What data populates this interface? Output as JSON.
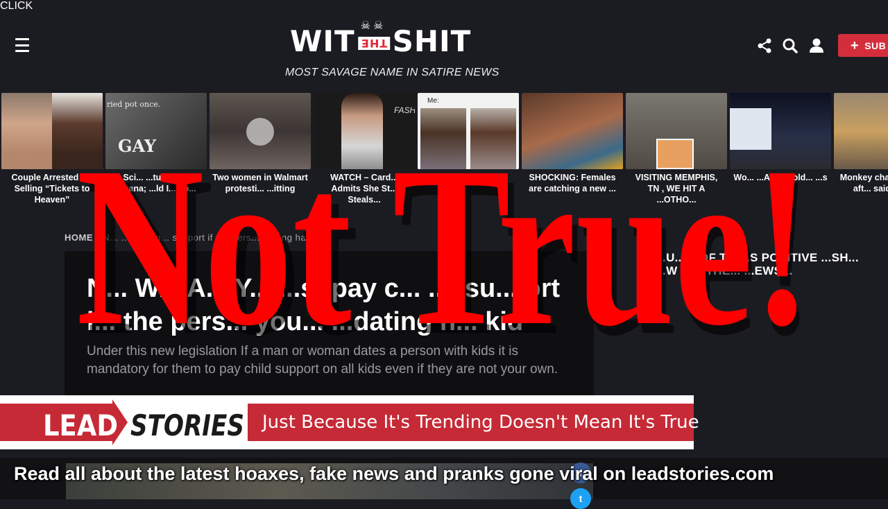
{
  "header": {
    "logo_left": "WIT",
    "logo_mid": "THE",
    "logo_right": "SHIT",
    "logo_small": "CLICK",
    "tagline": "MOST SAVAGE NAME IN SATIRE NEWS",
    "subscribe_label": "SUB"
  },
  "cards": [
    {
      "title": "Couple Arrested for Selling “Tickets to Heaven”"
    },
    {
      "title": "... Sci... ...tudy ...gest ...uana; ...ld I... Fo..."
    },
    {
      "title": "Two women in Walmart protesti... ...itting"
    },
    {
      "title": "WATCH – Card... Admits She St... Steals..."
    },
    {
      "title": "...ing to ...n to ...o"
    },
    {
      "title": "SHOCKING: Females are catching a new ..."
    },
    {
      "title": "VISITING MEMPHIS, TN , WE HIT A ...OTHO..."
    },
    {
      "title": "Wo... ...After Hold... ...s at"
    },
    {
      "title": "Monkey cha... assault aft... said “Da..."
    }
  ],
  "thumb_labels": {
    "card2_top": "ried pot once.",
    "card2_gay": "GAY",
    "card5_me": "Me:",
    "card3_brand": "FASHI"
  },
  "breadcrumb": {
    "home": "HOME",
    "rest": "N... ...V: ...t p... support if the pers... ...ating ha..."
  },
  "article": {
    "headline": "N... W... A... Y... ...st pay c... ...l su... ort i... the pers... you... ...dating h... kid",
    "summary": "Under this new legislation If a man or woman dates a person with kids it is mandatory for them to pay child support on all kids even if they are not your own."
  },
  "sidebar": {
    "text": "...U... ...OF T... ...S POSITIVE ...SH... ...W IN OTHE... ...EWS..."
  },
  "overlay": {
    "stamp": "Not True!",
    "brand_lead": "LEAD",
    "brand_stories": "STORIES",
    "banner_tagline": "Just Because It's Trending Doesn't Mean It's True",
    "bottom_text": "Read all about the latest hoaxes, fake news and pranks gone viral on leadstories.com"
  },
  "colors": {
    "accent": "#d42e3c",
    "stamp_red": "#ff0000",
    "lead_red": "#c62a36",
    "background": "#1b1c22"
  },
  "icons": [
    "menu-icon",
    "share-icon",
    "search-icon",
    "user-icon",
    "plus-icon",
    "play-icon",
    "facebook-icon",
    "twitter-icon"
  ]
}
